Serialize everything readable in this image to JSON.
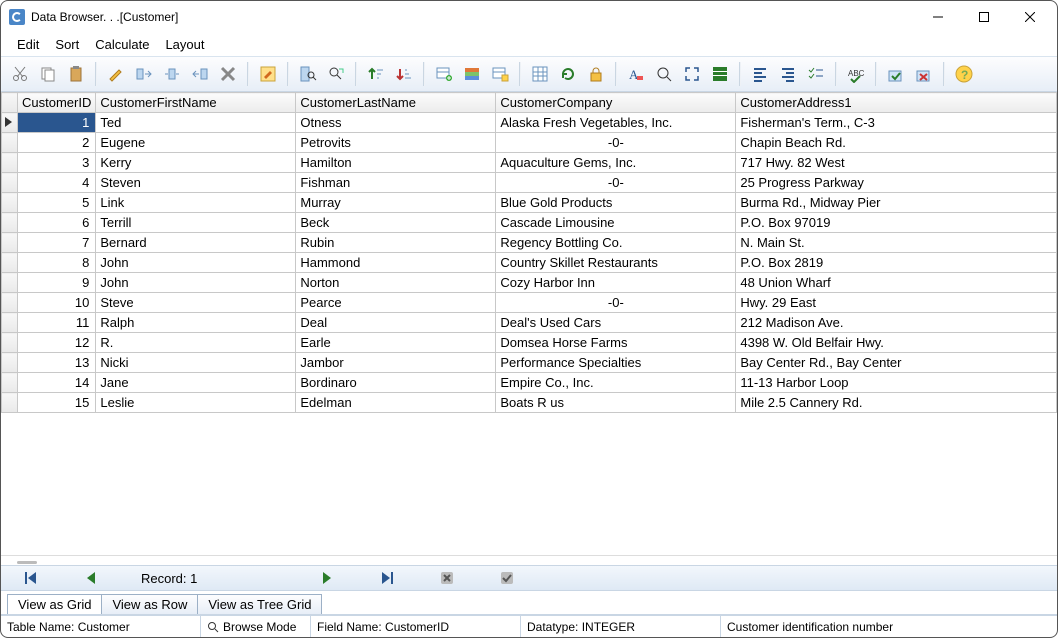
{
  "window": {
    "title": "Data Browser. . .[Customer]"
  },
  "menus": {
    "edit": "Edit",
    "sort": "Sort",
    "calculate": "Calculate",
    "layout": "Layout"
  },
  "columns": {
    "id": "CustomerID",
    "first": "CustomerFirstName",
    "last": "CustomerLastName",
    "company": "CustomerCompany",
    "address": "CustomerAddress1"
  },
  "rows": [
    {
      "id": "1",
      "first": "Ted",
      "last": "Otness",
      "company": "Alaska Fresh Vegetables, Inc.",
      "address": "Fisherman's Term., C-3"
    },
    {
      "id": "2",
      "first": "Eugene",
      "last": "Petrovits",
      "company": "-0-",
      "address": "Chapin Beach Rd."
    },
    {
      "id": "3",
      "first": "Kerry",
      "last": "Hamilton",
      "company": "Aquaculture Gems, Inc.",
      "address": "717 Hwy. 82 West"
    },
    {
      "id": "4",
      "first": "Steven",
      "last": "Fishman",
      "company": "-0-",
      "address": "25 Progress Parkway"
    },
    {
      "id": "5",
      "first": "Link",
      "last": "Murray",
      "company": "Blue Gold Products",
      "address": "Burma Rd., Midway Pier"
    },
    {
      "id": "6",
      "first": "Terrill",
      "last": "Beck",
      "company": "Cascade Limousine",
      "address": "P.O. Box 97019"
    },
    {
      "id": "7",
      "first": "Bernard",
      "last": "Rubin",
      "company": "Regency Bottling Co.",
      "address": "N. Main St."
    },
    {
      "id": "8",
      "first": "John",
      "last": "Hammond",
      "company": "Country Skillet Restaurants",
      "address": "P.O. Box 2819"
    },
    {
      "id": "9",
      "first": "John",
      "last": "Norton",
      "company": "Cozy Harbor Inn",
      "address": "48 Union Wharf"
    },
    {
      "id": "10",
      "first": "Steve",
      "last": "Pearce",
      "company": "-0-",
      "address": "Hwy. 29 East"
    },
    {
      "id": "11",
      "first": "Ralph",
      "last": "Deal",
      "company": "Deal's Used Cars",
      "address": "212 Madison Ave."
    },
    {
      "id": "12",
      "first": "R.",
      "last": "Earle",
      "company": "Domsea Horse Farms",
      "address": "4398 W. Old Belfair Hwy."
    },
    {
      "id": "13",
      "first": "Nicki",
      "last": "Jambor",
      "company": "Performance Specialties",
      "address": "Bay Center Rd., Bay Center"
    },
    {
      "id": "14",
      "first": "Jane",
      "last": "Bordinaro",
      "company": "Empire Co., Inc.",
      "address": "11-13 Harbor Loop"
    },
    {
      "id": "15",
      "first": "Leslie",
      "last": "Edelman",
      "company": "Boats R us",
      "address": "Mile 2.5 Cannery Rd."
    }
  ],
  "nav": {
    "record_label": "Record: 1"
  },
  "tabs": {
    "grid": "View as Grid",
    "row": "View as Row",
    "tree": "View as Tree Grid"
  },
  "status": {
    "table": "Table Name: Customer",
    "mode": "Browse Mode",
    "field": "Field Name: CustomerID",
    "datatype": "Datatype: INTEGER",
    "desc": "Customer identification number"
  }
}
